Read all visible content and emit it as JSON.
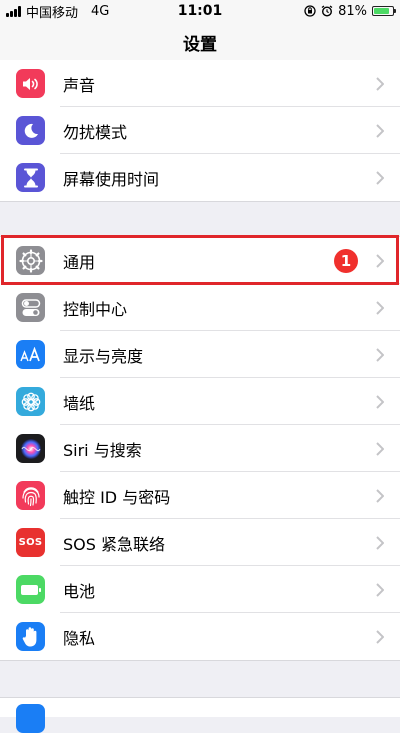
{
  "status_bar": {
    "carrier": "中国移动",
    "network": "4G",
    "time": "11:01",
    "battery": "81%",
    "battery_level": 0.81,
    "battery_color": "#4cd964"
  },
  "nav": {
    "title": "设置"
  },
  "badge_color": "#f0302d",
  "highlight_color": "#e0262a",
  "groups": [
    {
      "items": [
        {
          "label": "声音",
          "icon": "speaker-icon",
          "color": "#f23a5a"
        },
        {
          "label": "勿扰模式",
          "icon": "moon-icon",
          "color": "#5a55d6"
        },
        {
          "label": "屏幕使用时间",
          "icon": "hourglass-icon",
          "color": "#5a55d6"
        }
      ]
    },
    {
      "items": [
        {
          "label": "通用",
          "icon": "gear-icon",
          "color": "#8e8e93",
          "badge": "1"
        },
        {
          "label": "控制中心",
          "icon": "toggles-icon",
          "color": "#8e8e93"
        },
        {
          "label": "显示与亮度",
          "icon": "text-size-icon",
          "color": "#1a7ef5"
        },
        {
          "label": "墙纸",
          "icon": "flower-icon",
          "color": "#34aadc"
        },
        {
          "label": "Siri 与搜索",
          "icon": "siri-icon",
          "color": "#1c1c1e"
        },
        {
          "label": "触控 ID 与密码",
          "icon": "fingerprint-icon",
          "color": "#f23a5a"
        },
        {
          "label": "SOS 紧急联络",
          "icon": "sos-icon",
          "color": "#e8312f",
          "icon_text": "SOS"
        },
        {
          "label": "电池",
          "icon": "battery-icon",
          "color": "#4cd964"
        },
        {
          "label": "隐私",
          "icon": "hand-icon",
          "color": "#1a7ef5"
        }
      ]
    }
  ]
}
